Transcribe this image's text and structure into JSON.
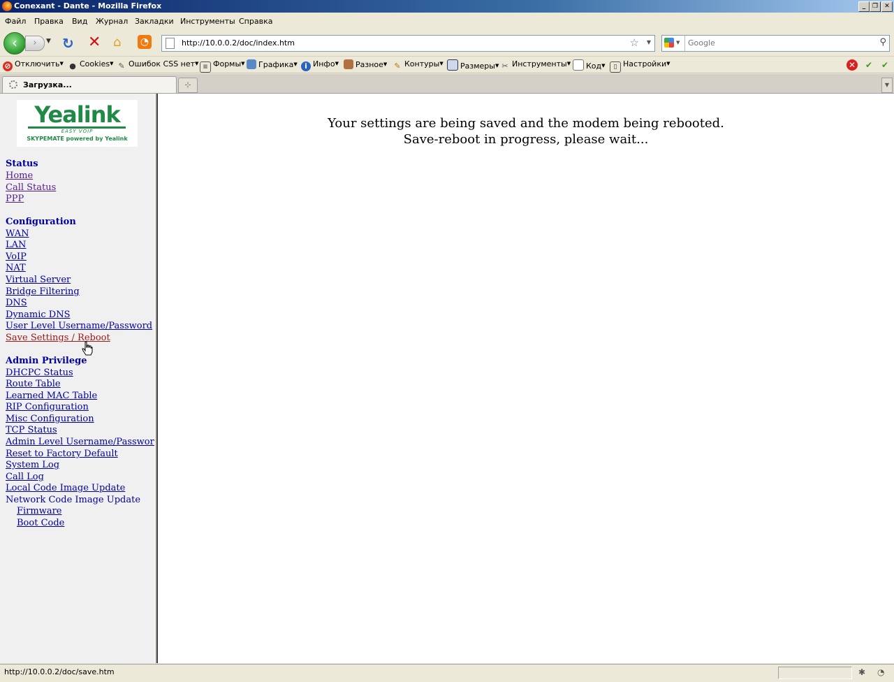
{
  "window": {
    "title": "Conexant - Dante - Mozilla Firefox",
    "controls": [
      "_",
      "❐",
      "✕"
    ]
  },
  "menu": [
    "Файл",
    "Правка",
    "Вид",
    "Журнал",
    "Закладки",
    "Инструменты",
    "Справка"
  ],
  "navigation": {
    "url": "http://10.0.0.2/doc/index.htm",
    "search_placeholder": "Google"
  },
  "devtoolbar": {
    "items": [
      "Отключить",
      "Cookies",
      "Ошибок CSS нет",
      "Формы",
      "Графика",
      "Инфо",
      "Разное",
      "Контуры",
      "Размеры",
      "Инструменты",
      "Код",
      "Настройки"
    ]
  },
  "tab": {
    "label": "Загрузка...",
    "new_tab_glyph": "⊹"
  },
  "sidebar": {
    "logo": {
      "brand": "Yealink",
      "tagline": "EASY VOIP",
      "subtitle": "SKYPEMATE powered by Yealink"
    },
    "sections": [
      {
        "heading": "Status",
        "links": [
          "Home",
          "Call Status",
          "PPP"
        ]
      },
      {
        "heading": "Configuration",
        "links": [
          "WAN",
          "LAN",
          "VoIP",
          "NAT",
          "Virtual Server",
          "Bridge Filtering",
          "DNS",
          "Dynamic DNS",
          "User Level Username/Password",
          "Save Settings / Reboot"
        ]
      },
      {
        "heading": "Admin Privilege",
        "links": [
          "DHCPC Status",
          "Route Table",
          "Learned MAC Table",
          "RIP Configuration",
          "Misc Configuration",
          "TCP Status",
          "Admin Level Username/Password",
          "Reset to Factory Default",
          "System Log",
          "Call Log",
          "Local Code Image Update"
        ],
        "text": "Network Code Image Update",
        "sublinks": [
          "Firmware",
          "Boot Code"
        ]
      }
    ]
  },
  "main": {
    "line1": "Your settings are being saved and the modem being rebooted.",
    "line2": "Save-reboot in progress, please wait..."
  },
  "statusbar": {
    "text": "http://10.0.0.2/doc/save.htm"
  }
}
